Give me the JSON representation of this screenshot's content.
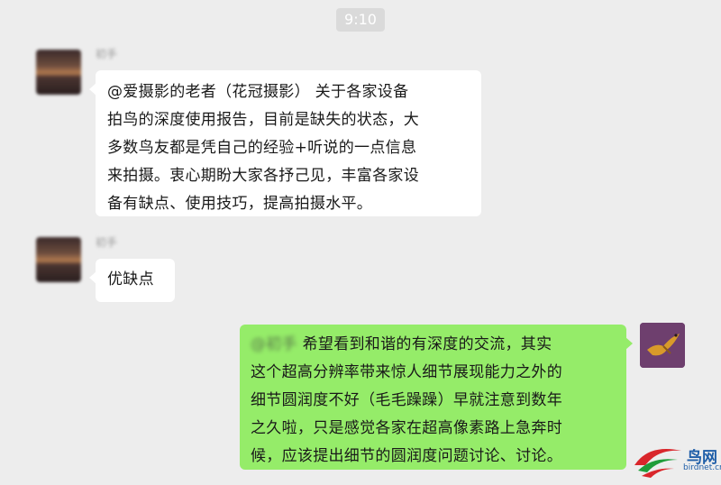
{
  "timestamp": "9:10",
  "messages": [
    {
      "sender": "初手",
      "side": "left",
      "text_lines": [
        "@爱摄影的老者（花冠摄影） 关于各家设备",
        "拍鸟的深度使用报告，目前是缺失的状态，大",
        "多数鸟友都是凭自己的经验+听说的一点信息",
        "来拍摄。衷心期盼大家各抒己见，丰富各家设",
        "备有缺点、使用技巧，提高拍摄水平。"
      ]
    },
    {
      "sender": "初手",
      "side": "left",
      "text_lines": [
        "优缺点"
      ]
    },
    {
      "side": "right",
      "mention": "@初手",
      "text_lines": [
        " 希望看到和谐的有深度的交流，其实",
        "这个超高分辨率带来惊人细节展现能力之外的",
        "细节圆润度不好（毛毛躁躁）早就注意到数年",
        "之久啦，只是感觉各家在超高像素路上急奔时",
        "候，应该提出细节的圆润度问题讨论、讨论。"
      ]
    }
  ],
  "watermark": {
    "logo_text": "鸟网",
    "site": "birdnet.cn",
    "colors": {
      "red": "#d9262b",
      "green": "#1f9d3a",
      "blue": "#1f5ea8"
    }
  },
  "colors": {
    "background": "#ededed",
    "left_bubble": "#ffffff",
    "right_bubble": "#95ec69"
  }
}
